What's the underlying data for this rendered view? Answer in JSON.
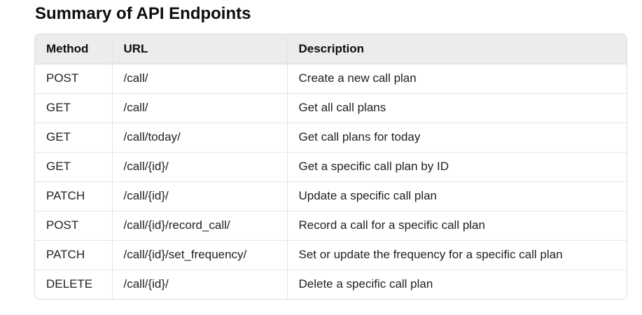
{
  "heading": "Summary of API Endpoints",
  "table": {
    "headers": [
      "Method",
      "URL",
      "Description"
    ],
    "rows": [
      [
        "POST",
        "/call/",
        "Create a new call plan"
      ],
      [
        "GET",
        "/call/",
        "Get all call plans"
      ],
      [
        "GET",
        "/call/today/",
        "Get call plans for today"
      ],
      [
        "GET",
        "/call/{id}/",
        "Get a specific call plan by ID"
      ],
      [
        "PATCH",
        "/call/{id}/",
        "Update a specific call plan"
      ],
      [
        "POST",
        "/call/{id}/record_call/",
        "Record a call for a specific call plan"
      ],
      [
        "PATCH",
        "/call/{id}/set_frequency/",
        "Set or update the frequency for a specific call plan"
      ],
      [
        "DELETE",
        "/call/{id}/",
        "Delete a specific call plan"
      ]
    ]
  }
}
